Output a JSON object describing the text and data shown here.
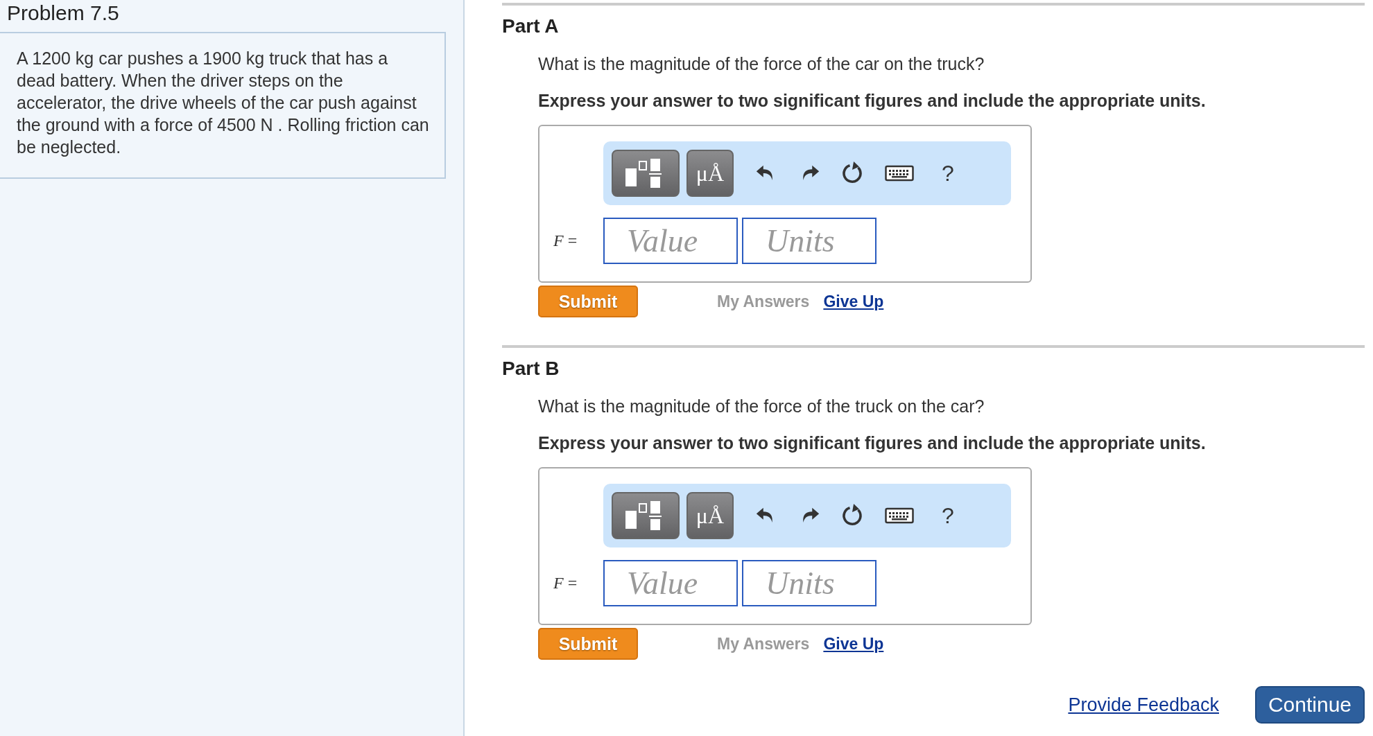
{
  "problem": {
    "title": "Problem 7.5",
    "text": "A 1200 kg car pushes a 1900 kg truck that has a dead battery. When the driver steps on the accelerator, the drive wheels of the car push against the ground with a force of 4500 N . Rolling friction can be neglected."
  },
  "parts": [
    {
      "label": "Part A",
      "question": "What is the magnitude of the force of the car on the truck?",
      "instruction": "Express your answer to two significant figures and include the appropriate units.",
      "toolbar": {
        "symbols": "μÅ",
        "help": "?"
      },
      "variable": "F",
      "equals": "=",
      "value_placeholder": "Value",
      "units_placeholder": "Units",
      "submit": "Submit",
      "my_answers": "My Answers",
      "give_up": "Give Up"
    },
    {
      "label": "Part B",
      "question": "What is the magnitude of the force of the truck on the car?",
      "instruction": "Express your answer to two significant figures and include the appropriate units.",
      "toolbar": {
        "symbols": "μÅ",
        "help": "?"
      },
      "variable": "F",
      "equals": "=",
      "value_placeholder": "Value",
      "units_placeholder": "Units",
      "submit": "Submit",
      "my_answers": "My Answers",
      "give_up": "Give Up"
    }
  ],
  "footer": {
    "feedback": "Provide Feedback",
    "continue": "Continue"
  }
}
